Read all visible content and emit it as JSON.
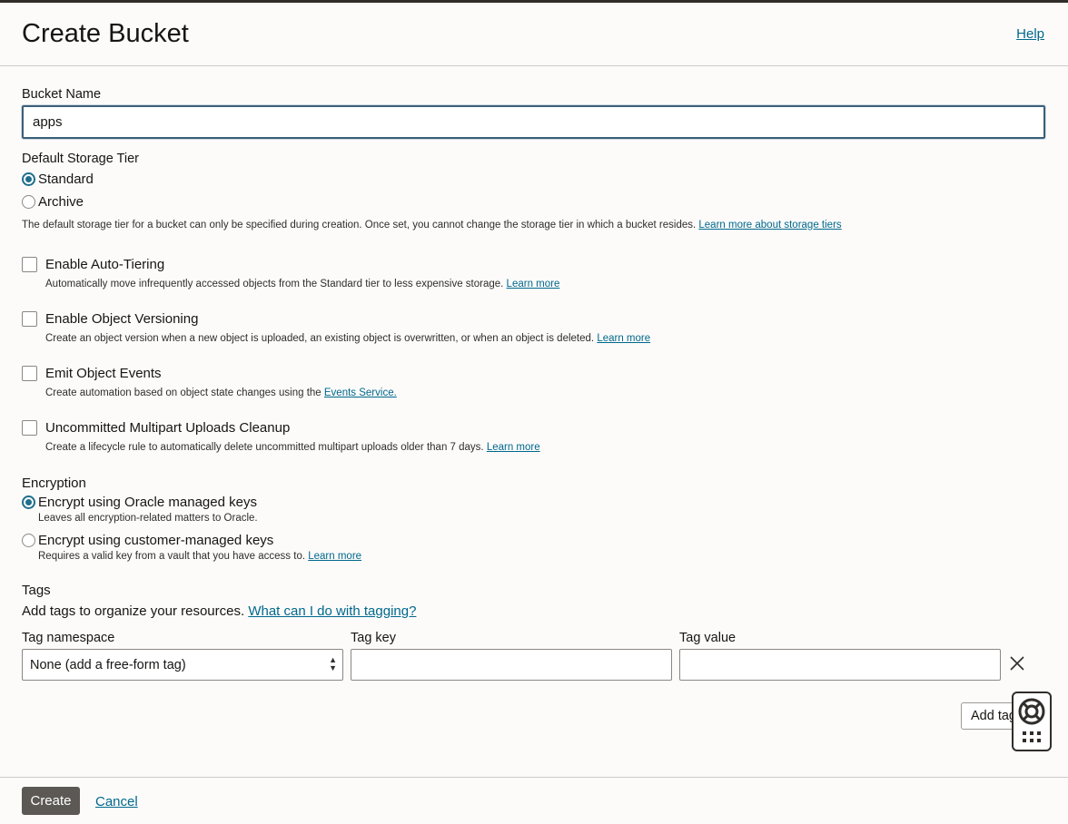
{
  "header": {
    "title": "Create Bucket",
    "help_label": "Help"
  },
  "bucket_name": {
    "label": "Bucket Name",
    "value": "apps"
  },
  "storage_tier": {
    "label": "Default Storage Tier",
    "options": [
      {
        "label": "Standard",
        "selected": true
      },
      {
        "label": "Archive",
        "selected": false
      }
    ],
    "note": "The default storage tier for a bucket can only be specified during creation. Once set, you cannot change the storage tier in which a bucket resides.",
    "note_link": "Learn more about storage tiers"
  },
  "options": [
    {
      "label": "Enable Auto-Tiering",
      "desc": "Automatically move infrequently accessed objects from the Standard tier to less expensive storage.",
      "link": "Learn more"
    },
    {
      "label": "Enable Object Versioning",
      "desc": "Create an object version when a new object is uploaded, an existing object is overwritten, or when an object is deleted.",
      "link": "Learn more"
    },
    {
      "label": "Emit Object Events",
      "desc": "Create automation based on object state changes using the",
      "link": "Events Service."
    },
    {
      "label": "Uncommitted Multipart Uploads Cleanup",
      "desc": "Create a lifecycle rule to automatically delete uncommitted multipart uploads older than 7 days.",
      "link": "Learn more"
    }
  ],
  "encryption": {
    "label": "Encryption",
    "options": [
      {
        "label": "Encrypt using Oracle managed keys",
        "desc": "Leaves all encryption-related matters to Oracle.",
        "link": ""
      },
      {
        "label": "Encrypt using customer-managed keys",
        "desc": "Requires a valid key from a vault that you have access to.",
        "link": "Learn more"
      }
    ]
  },
  "tags": {
    "label": "Tags",
    "intro": "Add tags to organize your resources.",
    "intro_link": "What can I do with tagging?",
    "namespace_label": "Tag namespace",
    "namespace_value": "None (add a free-form tag)",
    "key_label": "Tag key",
    "value_label": "Tag value",
    "key_value": "",
    "value_value": "",
    "add_tag_label": "Add tag"
  },
  "footer": {
    "create_label": "Create",
    "cancel_label": "Cancel"
  },
  "icons": {
    "remove": "close-icon",
    "support": "lifebuoy-icon",
    "apps": "grid-icon"
  },
  "colors": {
    "accent": "#00688c",
    "primary_button": "#5c5955",
    "selected_radio": "#1f6e8c"
  }
}
